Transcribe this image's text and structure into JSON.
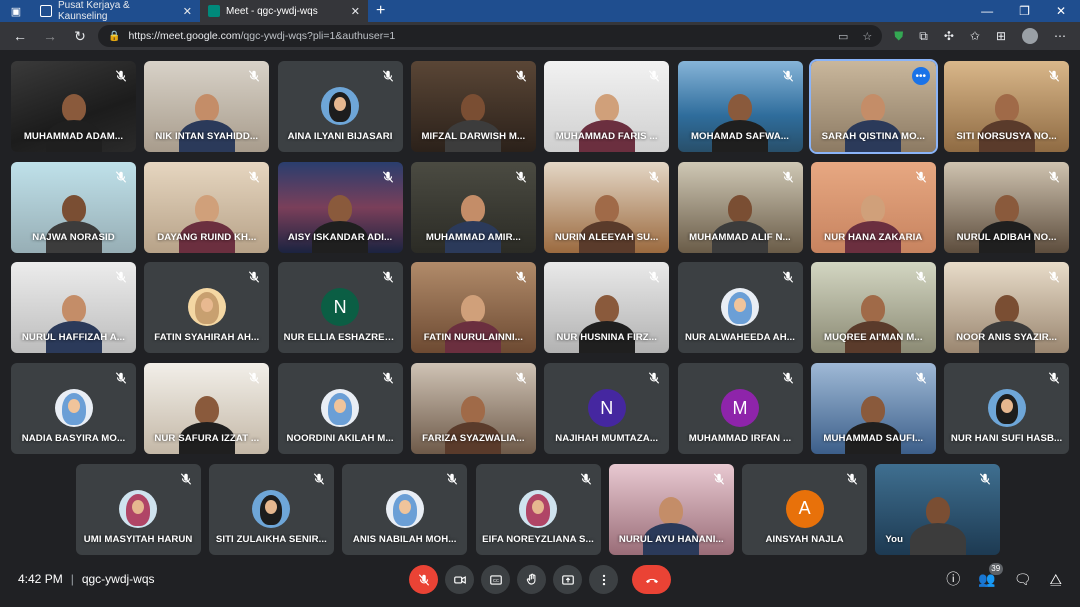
{
  "browser": {
    "tabs": [
      {
        "title": "Pusat Kerjaya & Kaunseling",
        "active": false
      },
      {
        "title": "Meet - qgc-ywdj-wqs",
        "active": true
      }
    ],
    "address": {
      "host": "https://meet.google.com",
      "path": "/qgc-ywdj-wqs?pli=1&authuser=1"
    }
  },
  "participants": [
    {
      "name": "MUHAMMAD ADAM...",
      "kind": "video",
      "bg": "v1"
    },
    {
      "name": "NIK INTAN SYAHIDD...",
      "kind": "video",
      "bg": "v2"
    },
    {
      "name": "AINA ILYANI BIJASARI",
      "kind": "avatar",
      "avatar": "hijab-a"
    },
    {
      "name": "MIFZAL DARWISH M...",
      "kind": "video",
      "bg": "v3"
    },
    {
      "name": "MUHAMMAD FARIS ...",
      "kind": "video",
      "bg": "v4"
    },
    {
      "name": "MOHAMAD SAFWA...",
      "kind": "video",
      "bg": "v5"
    },
    {
      "name": "SARAH QISTINA MO...",
      "kind": "video",
      "bg": "v6",
      "speaking": true
    },
    {
      "name": "SITI NORSUSYA NO...",
      "kind": "video",
      "bg": "v7"
    },
    {
      "name": "NAJWA NORASID",
      "kind": "video",
      "bg": "v8"
    },
    {
      "name": "DAYANG RUIND KH...",
      "kind": "video",
      "bg": "v10"
    },
    {
      "name": "AISY ISKANDAR ADI...",
      "kind": "video",
      "bg": "v11"
    },
    {
      "name": "MUHAMMAD AMIR...",
      "kind": "video",
      "bg": "v12"
    },
    {
      "name": "NURIN ALEEYAH SU...",
      "kind": "video",
      "bg": "v13"
    },
    {
      "name": "MUHAMMAD ALIF N...",
      "kind": "video",
      "bg": "v14"
    },
    {
      "name": "NUR HANA ZAKARIA",
      "kind": "video",
      "bg": "v15"
    },
    {
      "name": "NURUL ADIBAH NO...",
      "kind": "video",
      "bg": "v16"
    },
    {
      "name": "NURUL HAFFIZAH A...",
      "kind": "video",
      "bg": "v17"
    },
    {
      "name": "FATIN SYAHIRAH AH...",
      "kind": "avatar",
      "avatar": "hijab-b"
    },
    {
      "name": "NUR ELLIA ESHAZREE...",
      "kind": "letter",
      "letter": "N",
      "color": "#0b5e44"
    },
    {
      "name": "FATIN NURULAINNI...",
      "kind": "video",
      "bg": "v18"
    },
    {
      "name": "NUR HUSNINA FIRZ...",
      "kind": "video",
      "bg": "v19"
    },
    {
      "name": "NUR ALWAHEEDA AH...",
      "kind": "avatar",
      "avatar": "hijab-c"
    },
    {
      "name": "MUQREE AI'MAN M...",
      "kind": "video",
      "bg": "v20"
    },
    {
      "name": "NOOR ANIS SYAZIR...",
      "kind": "video",
      "bg": "v21"
    },
    {
      "name": "NADIA BASYIRA MO...",
      "kind": "avatar",
      "avatar": "hijab-c"
    },
    {
      "name": "NUR SAFURA IZZAT ...",
      "kind": "video",
      "bg": "v22"
    },
    {
      "name": "NOORDINI AKILAH M...",
      "kind": "avatar",
      "avatar": "hijab-c"
    },
    {
      "name": "FARIZA SYAZWALIA...",
      "kind": "video",
      "bg": "v23"
    },
    {
      "name": "NAJIHAH MUMTAZA...",
      "kind": "letter",
      "letter": "N",
      "color": "#4527a0"
    },
    {
      "name": "MUHAMMAD IRFAN ...",
      "kind": "letter",
      "letter": "M",
      "color": "#8e24aa"
    },
    {
      "name": "MUHAMMAD SAUFI...",
      "kind": "video",
      "bg": "v25"
    },
    {
      "name": "NUR HANI SUFI HASB...",
      "kind": "avatar",
      "avatar": "hijab-a"
    },
    {
      "name": "UMI MASYITAH HARUN",
      "kind": "avatar",
      "avatar": "hijab-d"
    },
    {
      "name": "SITI ZULAIKHA SENIR...",
      "kind": "avatar",
      "avatar": "hijab-a"
    },
    {
      "name": "ANIS NABILAH MOH...",
      "kind": "avatar",
      "avatar": "hijab-c"
    },
    {
      "name": "EIFA NOREYZLIANA S...",
      "kind": "avatar",
      "avatar": "hijab-d"
    },
    {
      "name": "NURUL AYU HANANI...",
      "kind": "video",
      "bg": "v26"
    },
    {
      "name": "AINSYAH NAJLA",
      "kind": "letter",
      "letter": "A",
      "color": "#e8710a"
    },
    {
      "name": "You",
      "kind": "video",
      "bg": "v27",
      "self": true
    }
  ],
  "meeting": {
    "time": "4:42 PM",
    "code": "qgc-ywdj-wqs",
    "participant_count": "39"
  },
  "colors": {
    "accent": "#8ab4f8",
    "end_call": "#ea4335",
    "background": "#202124",
    "tile": "#3c4043"
  }
}
